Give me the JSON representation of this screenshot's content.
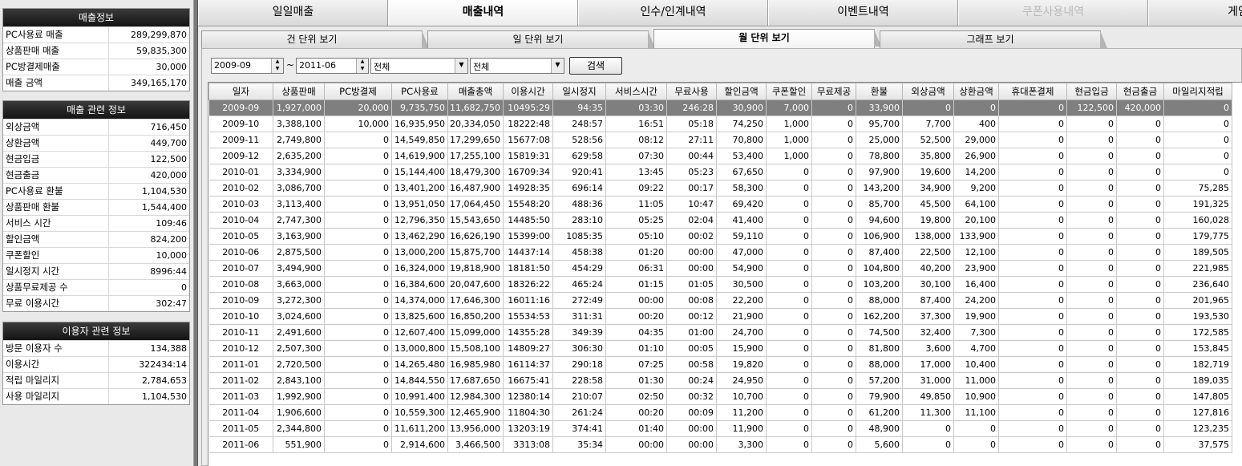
{
  "sales_info": {
    "title": "매출정보",
    "rows": [
      {
        "label": "PC사용료 매출",
        "value": "289,299,870"
      },
      {
        "label": "상품판매 매출",
        "value": "59,835,300"
      },
      {
        "label": "PC방결제매출",
        "value": "30,000"
      },
      {
        "label": "매출 금액",
        "value": "349,165,170"
      }
    ]
  },
  "sales_related": {
    "title": "매출 관련 정보",
    "rows": [
      {
        "label": "외상금액",
        "value": "716,450"
      },
      {
        "label": "상환금액",
        "value": "449,700"
      },
      {
        "label": "현금입금",
        "value": "122,500"
      },
      {
        "label": "현금출금",
        "value": "420,000"
      },
      {
        "label": "PC사용료 환불",
        "value": "1,104,530"
      },
      {
        "label": "상품판매 환불",
        "value": "1,544,400"
      },
      {
        "label": "서비스 시간",
        "value": "109:46"
      },
      {
        "label": "할인금액",
        "value": "824,200"
      },
      {
        "label": "쿠폰할인",
        "value": "10,000"
      },
      {
        "label": "일시정지 시간",
        "value": "8996:44"
      },
      {
        "label": "상품무료제공 수",
        "value": "0"
      },
      {
        "label": "무료 이용시간",
        "value": "302:47"
      }
    ]
  },
  "user_related": {
    "title": "이용자 관련 정보",
    "rows": [
      {
        "label": "방문 이용자 수",
        "value": "134,388"
      },
      {
        "label": "이용시간",
        "value": "322434:14"
      },
      {
        "label": "적립 마일리지",
        "value": "2,784,653"
      },
      {
        "label": "사용 마일리지",
        "value": "1,104,530"
      }
    ]
  },
  "main_tabs": [
    "일일매출",
    "매출내역",
    "인수/인계내역",
    "이벤트내역",
    "쿠폰사용내역",
    "게임사"
  ],
  "sub_tabs": [
    "건 단위 보기",
    "일 단위 보기",
    "월 단위 보기",
    "그래프 보기"
  ],
  "filters": {
    "from": "2009-09",
    "tilde": "~",
    "to": "2011-06",
    "combo1": "전체",
    "combo2": "전체",
    "search_label": "검색",
    "spin_up": "▲",
    "spin_down": "▼",
    "dropdown_glyph": "▼"
  },
  "table": {
    "headers": [
      "일자",
      "상품판매",
      "PC방결제",
      "PC사용료",
      "매출총액",
      "이용시간",
      "일시정지",
      "서비스시간",
      "무료사용",
      "할인금액",
      "쿠폰할인",
      "무료제공",
      "환불",
      "외상금액",
      "상환금액",
      "휴대폰결제",
      "현금입금",
      "현금출금",
      "마일리지적립"
    ],
    "rows": [
      [
        "2009-09",
        "1,927,000",
        "20,000",
        "9,735,750",
        "11,682,750",
        "10495:29",
        "94:35",
        "03:30",
        "246:28",
        "30,900",
        "7,000",
        "0",
        "33,900",
        "0",
        "0",
        "0",
        "122,500",
        "420,000",
        "0"
      ],
      [
        "2009-10",
        "3,388,100",
        "10,000",
        "16,935,950",
        "20,334,050",
        "18222:48",
        "248:57",
        "16:51",
        "05:18",
        "74,250",
        "1,000",
        "0",
        "95,700",
        "7,700",
        "400",
        "0",
        "0",
        "0",
        "0"
      ],
      [
        "2009-11",
        "2,749,800",
        "0",
        "14,549,850",
        "17,299,650",
        "15677:08",
        "528:56",
        "08:12",
        "27:11",
        "70,800",
        "1,000",
        "0",
        "25,000",
        "52,500",
        "29,000",
        "0",
        "0",
        "0",
        "0"
      ],
      [
        "2009-12",
        "2,635,200",
        "0",
        "14,619,900",
        "17,255,100",
        "15819:31",
        "629:58",
        "07:30",
        "00:44",
        "53,400",
        "1,000",
        "0",
        "78,800",
        "35,800",
        "26,900",
        "0",
        "0",
        "0",
        "0"
      ],
      [
        "2010-01",
        "3,334,900",
        "0",
        "15,144,400",
        "18,479,300",
        "16709:34",
        "920:41",
        "13:45",
        "05:23",
        "67,650",
        "0",
        "0",
        "97,900",
        "19,600",
        "14,200",
        "0",
        "0",
        "0",
        "0"
      ],
      [
        "2010-02",
        "3,086,700",
        "0",
        "13,401,200",
        "16,487,900",
        "14928:35",
        "696:14",
        "09:22",
        "00:17",
        "58,300",
        "0",
        "0",
        "143,200",
        "34,900",
        "9,200",
        "0",
        "0",
        "0",
        "75,285"
      ],
      [
        "2010-03",
        "3,113,400",
        "0",
        "13,951,050",
        "17,064,450",
        "15548:20",
        "488:36",
        "11:05",
        "10:47",
        "69,420",
        "0",
        "0",
        "85,700",
        "45,500",
        "64,100",
        "0",
        "0",
        "0",
        "191,325"
      ],
      [
        "2010-04",
        "2,747,300",
        "0",
        "12,796,350",
        "15,543,650",
        "14485:50",
        "283:10",
        "05:25",
        "02:04",
        "41,400",
        "0",
        "0",
        "94,600",
        "19,800",
        "20,100",
        "0",
        "0",
        "0",
        "160,028"
      ],
      [
        "2010-05",
        "3,163,900",
        "0",
        "13,462,290",
        "16,626,190",
        "15399:00",
        "1085:35",
        "05:10",
        "00:02",
        "59,110",
        "0",
        "0",
        "106,900",
        "138,000",
        "133,900",
        "0",
        "0",
        "0",
        "179,775"
      ],
      [
        "2010-06",
        "2,875,500",
        "0",
        "13,000,200",
        "15,875,700",
        "14437:14",
        "458:38",
        "01:20",
        "00:00",
        "47,000",
        "0",
        "0",
        "87,400",
        "22,500",
        "12,100",
        "0",
        "0",
        "0",
        "189,505"
      ],
      [
        "2010-07",
        "3,494,900",
        "0",
        "16,324,000",
        "19,818,900",
        "18181:50",
        "454:29",
        "06:31",
        "00:00",
        "54,900",
        "0",
        "0",
        "104,800",
        "40,200",
        "23,900",
        "0",
        "0",
        "0",
        "221,985"
      ],
      [
        "2010-08",
        "3,663,000",
        "0",
        "16,384,600",
        "20,047,600",
        "18326:22",
        "465:24",
        "01:15",
        "01:05",
        "30,500",
        "0",
        "0",
        "103,200",
        "30,100",
        "16,400",
        "0",
        "0",
        "0",
        "236,640"
      ],
      [
        "2010-09",
        "3,272,300",
        "0",
        "14,374,000",
        "17,646,300",
        "16011:16",
        "272:49",
        "00:00",
        "00:08",
        "22,200",
        "0",
        "0",
        "88,000",
        "87,400",
        "24,200",
        "0",
        "0",
        "0",
        "201,965"
      ],
      [
        "2010-10",
        "3,024,600",
        "0",
        "13,825,600",
        "16,850,200",
        "15534:53",
        "311:31",
        "00:20",
        "00:12",
        "21,900",
        "0",
        "0",
        "162,200",
        "37,300",
        "19,900",
        "0",
        "0",
        "0",
        "193,530"
      ],
      [
        "2010-11",
        "2,491,600",
        "0",
        "12,607,400",
        "15,099,000",
        "14355:28",
        "349:39",
        "04:35",
        "01:00",
        "24,700",
        "0",
        "0",
        "74,500",
        "32,400",
        "7,300",
        "0",
        "0",
        "0",
        "172,585"
      ],
      [
        "2010-12",
        "2,507,300",
        "0",
        "13,000,800",
        "15,508,100",
        "14809:27",
        "306:30",
        "01:10",
        "00:05",
        "15,900",
        "0",
        "0",
        "81,800",
        "3,600",
        "4,700",
        "0",
        "0",
        "0",
        "153,845"
      ],
      [
        "2011-01",
        "2,720,500",
        "0",
        "14,265,480",
        "16,985,980",
        "16114:37",
        "290:18",
        "07:25",
        "00:58",
        "19,820",
        "0",
        "0",
        "88,000",
        "17,000",
        "10,400",
        "0",
        "0",
        "0",
        "182,719"
      ],
      [
        "2011-02",
        "2,843,100",
        "0",
        "14,844,550",
        "17,687,650",
        "16675:41",
        "228:58",
        "01:30",
        "00:24",
        "24,950",
        "0",
        "0",
        "57,200",
        "31,000",
        "11,000",
        "0",
        "0",
        "0",
        "189,035"
      ],
      [
        "2011-03",
        "1,992,900",
        "0",
        "10,991,400",
        "12,984,300",
        "12380:14",
        "210:07",
        "02:50",
        "00:32",
        "10,700",
        "0",
        "0",
        "79,900",
        "49,850",
        "10,900",
        "0",
        "0",
        "0",
        "147,805"
      ],
      [
        "2011-04",
        "1,906,600",
        "0",
        "10,559,300",
        "12,465,900",
        "11804:30",
        "261:24",
        "00:20",
        "00:09",
        "11,200",
        "0",
        "0",
        "61,200",
        "11,300",
        "11,100",
        "0",
        "0",
        "0",
        "127,816"
      ],
      [
        "2011-05",
        "2,344,800",
        "0",
        "11,611,200",
        "13,956,000",
        "13203:19",
        "374:41",
        "01:40",
        "00:00",
        "11,900",
        "0",
        "0",
        "48,900",
        "0",
        "0",
        "0",
        "0",
        "0",
        "123,235"
      ],
      [
        "2011-06",
        "551,900",
        "0",
        "2,914,600",
        "3,466,500",
        "3313:08",
        "35:34",
        "00:00",
        "00:00",
        "3,300",
        "0",
        "0",
        "5,600",
        "0",
        "0",
        "0",
        "0",
        "0",
        "37,575"
      ]
    ]
  }
}
